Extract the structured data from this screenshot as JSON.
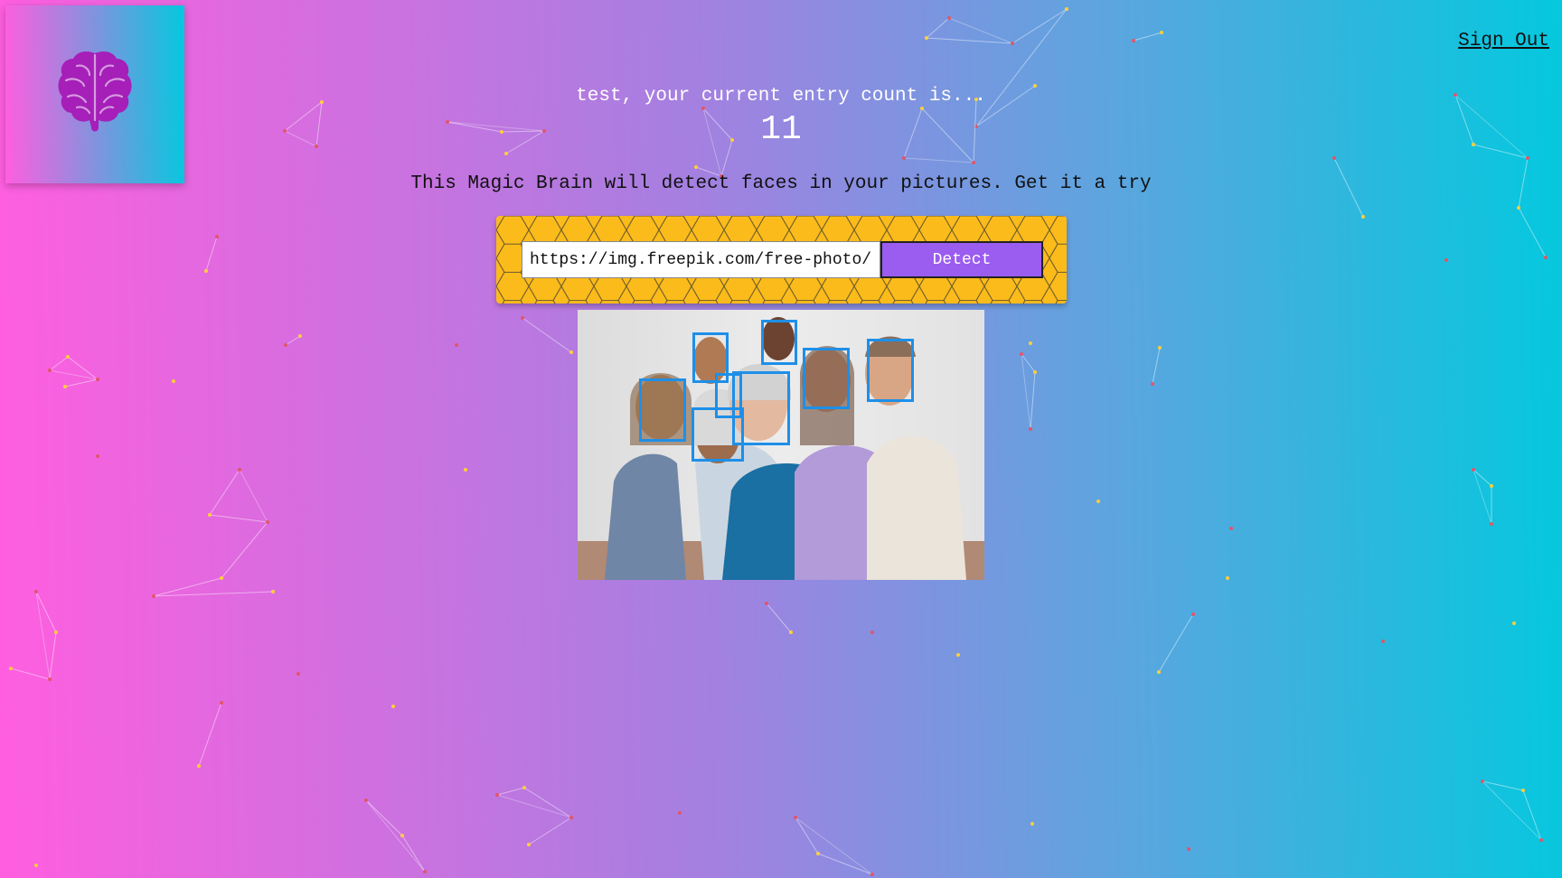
{
  "app": {
    "logo_icon": "brain-icon",
    "logo_color": "#a51fb8"
  },
  "header": {
    "sign_out_label": "Sign Out"
  },
  "rank": {
    "greeting": "test, your current entry count is...",
    "entry_count": "11"
  },
  "main": {
    "tagline": "This Magic Brain will detect faces in your pictures. Get it a try"
  },
  "image_form": {
    "url_value": "https://img.freepik.com/free-photo/",
    "detect_label": "Detect",
    "button_color": "#9b5cf0",
    "panel_color": "#fbbb1b"
  },
  "result": {
    "image_icon": "group-photo-image",
    "face_box_color": "#1e8fe8",
    "face_count": 8
  },
  "background": {
    "gradient_start": "#ff5edf",
    "gradient_end": "#04c8de"
  }
}
